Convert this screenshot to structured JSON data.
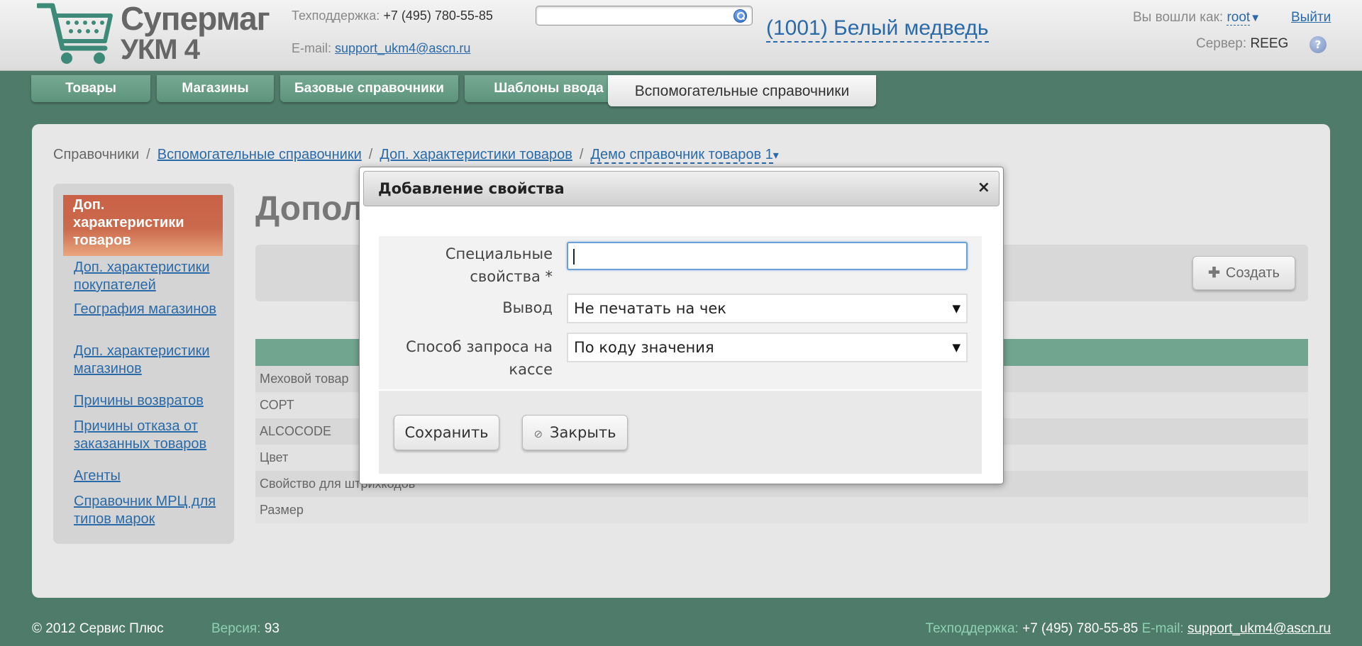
{
  "header": {
    "logo": {
      "line1": "Супермаг",
      "line2": "УКМ 4"
    },
    "support": {
      "phone_label": "Техподдержка:",
      "phone": "+7 (495) 780-55-85",
      "email_label": "E-mail:",
      "email": "support_ukm4@ascn.ru"
    },
    "search": {
      "value": ""
    },
    "store": "(1001) Белый медведь",
    "login_label": "Вы вошли как:",
    "user": "root",
    "logout": "Выйти",
    "server_label": "Сервер:",
    "server": "REEG",
    "help": "?"
  },
  "tabs": [
    {
      "label": "Товары"
    },
    {
      "label": "Магазины"
    },
    {
      "label": "Базовые справочники"
    },
    {
      "label": "Шаблоны ввода"
    },
    {
      "label": "Вспомогательные справочники",
      "active": true
    }
  ],
  "breadcrumb": {
    "root": "Справочники",
    "sep": "/",
    "link1": "Вспомогательные справочники",
    "link2": "Доп. характеристики товаров",
    "current": "Демо справочник товаров 1",
    "arrow": "▾"
  },
  "sidebar": {
    "active": "Доп. характеристики товаров",
    "items": [
      "Доп. характеристики покупателей",
      "География магазинов",
      "Доп. характеристики магазинов",
      "Причины возвратов",
      "Причины отказа от заказанных товаров",
      "Агенты",
      "Справочник МРЦ для типов марок"
    ]
  },
  "main": {
    "title": "Допол",
    "create_button": "Создать",
    "rows": [
      "Меховой товар",
      "СОРТ",
      "ALCOCODE",
      "Цвет",
      "Свойство для штрихкодов",
      "Размер"
    ]
  },
  "modal": {
    "title": "Добавление свойства",
    "close": "×",
    "fields": {
      "special_label": "Специальные свойства *",
      "special_value": "",
      "output_label": "Вывод",
      "output_value": "Не печатать на чек",
      "request_label": "Способ запроса на кассе",
      "request_value": "По коду значения"
    },
    "save": "Сохранить",
    "close_button": "Закрыть"
  },
  "footer": {
    "copyright": "© 2012 Сервис Плюс",
    "version_label": "Версия:",
    "version": "93",
    "support_label": "Техподдержка:",
    "support_phone": "+7 (495) 780-55-85",
    "email_label": "E-mail:",
    "email": "support_ukm4@ascn.ru"
  },
  "colors": {
    "background": "#4f7b6a",
    "tab": "#6a9e87",
    "active_sidebar": "#c96147",
    "link": "#2a6aa8"
  }
}
